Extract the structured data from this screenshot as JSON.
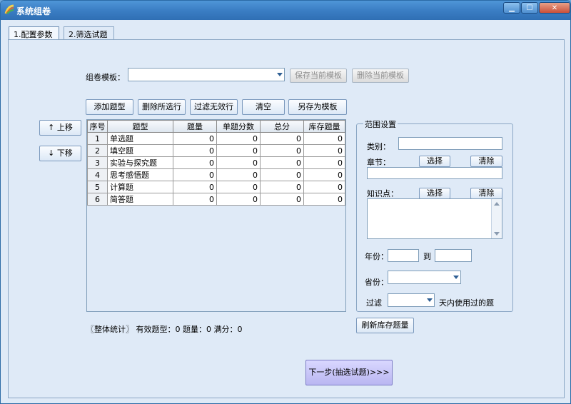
{
  "window": {
    "title": "系统组卷",
    "min": "▁",
    "max": "☐",
    "close": "✕"
  },
  "tabs": [
    {
      "label": "1.配置参数"
    },
    {
      "label": "2.筛选试题"
    }
  ],
  "template": {
    "label": "组卷模板：",
    "value": "",
    "save_btn": "保存当前模板",
    "delete_btn": "删除当前模板"
  },
  "toolbar": {
    "add": "添加题型",
    "delete_selected": "删除所选行",
    "filter_invalid": "过滤无效行",
    "clear": "清空",
    "save_as_template": "另存为模板"
  },
  "move": {
    "up": "↑ 上移",
    "down": "↓ 下移"
  },
  "grid": {
    "columns": [
      "序号",
      "题型",
      "题量",
      "单题分数",
      "总分",
      "库存题量"
    ],
    "rows": [
      [
        "1",
        "单选题",
        "0",
        "0",
        "0",
        "0"
      ],
      [
        "2",
        "填空题",
        "0",
        "0",
        "0",
        "0"
      ],
      [
        "3",
        "实验与探究题",
        "0",
        "0",
        "0",
        "0"
      ],
      [
        "4",
        "思考感悟题",
        "0",
        "0",
        "0",
        "0"
      ],
      [
        "5",
        "计算题",
        "0",
        "0",
        "0",
        "0"
      ],
      [
        "6",
        "简答题",
        "0",
        "0",
        "0",
        "0"
      ]
    ]
  },
  "range": {
    "title": "范围设置",
    "category_label": "类别：",
    "category_value": "",
    "chapter_label": "章节：",
    "chapter_select": "选择",
    "chapter_clear": "清除",
    "chapter_value": "",
    "knowledge_label": "知识点：",
    "knowledge_select": "选择",
    "knowledge_clear": "清除",
    "knowledge_value": "",
    "year_label": "年份：",
    "year_from": "",
    "year_to_label": "到",
    "year_to": "",
    "province_label": "省份：",
    "province_value": "",
    "filter_label": "过滤",
    "filter_value": "",
    "filter_suffix": "天内使用过的题"
  },
  "refresh_btn": "刷新库存题量",
  "stats": "〖整体统计〗 有效题型：0   题量：0   满分：0",
  "next_btn": "下一步(抽选试题)>>>",
  "colors": {
    "title_bar": "#3b7ec4",
    "window_bg": "#dfeaf7",
    "next_button": "#c3c0f6"
  }
}
